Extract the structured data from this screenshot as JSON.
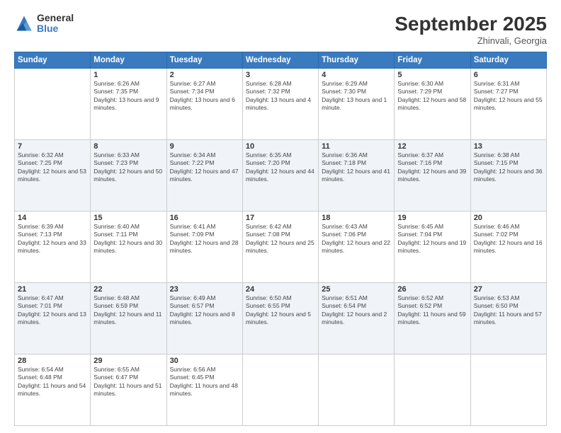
{
  "logo": {
    "general": "General",
    "blue": "Blue"
  },
  "header": {
    "month": "September 2025",
    "location": "Zhinvali, Georgia"
  },
  "days_of_week": [
    "Sunday",
    "Monday",
    "Tuesday",
    "Wednesday",
    "Thursday",
    "Friday",
    "Saturday"
  ],
  "weeks": [
    [
      {
        "day": "",
        "sunrise": "",
        "sunset": "",
        "daylight": ""
      },
      {
        "day": "1",
        "sunrise": "Sunrise: 6:26 AM",
        "sunset": "Sunset: 7:35 PM",
        "daylight": "Daylight: 13 hours and 9 minutes."
      },
      {
        "day": "2",
        "sunrise": "Sunrise: 6:27 AM",
        "sunset": "Sunset: 7:34 PM",
        "daylight": "Daylight: 13 hours and 6 minutes."
      },
      {
        "day": "3",
        "sunrise": "Sunrise: 6:28 AM",
        "sunset": "Sunset: 7:32 PM",
        "daylight": "Daylight: 13 hours and 4 minutes."
      },
      {
        "day": "4",
        "sunrise": "Sunrise: 6:29 AM",
        "sunset": "Sunset: 7:30 PM",
        "daylight": "Daylight: 13 hours and 1 minute."
      },
      {
        "day": "5",
        "sunrise": "Sunrise: 6:30 AM",
        "sunset": "Sunset: 7:29 PM",
        "daylight": "Daylight: 12 hours and 58 minutes."
      },
      {
        "day": "6",
        "sunrise": "Sunrise: 6:31 AM",
        "sunset": "Sunset: 7:27 PM",
        "daylight": "Daylight: 12 hours and 55 minutes."
      }
    ],
    [
      {
        "day": "7",
        "sunrise": "Sunrise: 6:32 AM",
        "sunset": "Sunset: 7:25 PM",
        "daylight": "Daylight: 12 hours and 53 minutes."
      },
      {
        "day": "8",
        "sunrise": "Sunrise: 6:33 AM",
        "sunset": "Sunset: 7:23 PM",
        "daylight": "Daylight: 12 hours and 50 minutes."
      },
      {
        "day": "9",
        "sunrise": "Sunrise: 6:34 AM",
        "sunset": "Sunset: 7:22 PM",
        "daylight": "Daylight: 12 hours and 47 minutes."
      },
      {
        "day": "10",
        "sunrise": "Sunrise: 6:35 AM",
        "sunset": "Sunset: 7:20 PM",
        "daylight": "Daylight: 12 hours and 44 minutes."
      },
      {
        "day": "11",
        "sunrise": "Sunrise: 6:36 AM",
        "sunset": "Sunset: 7:18 PM",
        "daylight": "Daylight: 12 hours and 41 minutes."
      },
      {
        "day": "12",
        "sunrise": "Sunrise: 6:37 AM",
        "sunset": "Sunset: 7:16 PM",
        "daylight": "Daylight: 12 hours and 39 minutes."
      },
      {
        "day": "13",
        "sunrise": "Sunrise: 6:38 AM",
        "sunset": "Sunset: 7:15 PM",
        "daylight": "Daylight: 12 hours and 36 minutes."
      }
    ],
    [
      {
        "day": "14",
        "sunrise": "Sunrise: 6:39 AM",
        "sunset": "Sunset: 7:13 PM",
        "daylight": "Daylight: 12 hours and 33 minutes."
      },
      {
        "day": "15",
        "sunrise": "Sunrise: 6:40 AM",
        "sunset": "Sunset: 7:11 PM",
        "daylight": "Daylight: 12 hours and 30 minutes."
      },
      {
        "day": "16",
        "sunrise": "Sunrise: 6:41 AM",
        "sunset": "Sunset: 7:09 PM",
        "daylight": "Daylight: 12 hours and 28 minutes."
      },
      {
        "day": "17",
        "sunrise": "Sunrise: 6:42 AM",
        "sunset": "Sunset: 7:08 PM",
        "daylight": "Daylight: 12 hours and 25 minutes."
      },
      {
        "day": "18",
        "sunrise": "Sunrise: 6:43 AM",
        "sunset": "Sunset: 7:06 PM",
        "daylight": "Daylight: 12 hours and 22 minutes."
      },
      {
        "day": "19",
        "sunrise": "Sunrise: 6:45 AM",
        "sunset": "Sunset: 7:04 PM",
        "daylight": "Daylight: 12 hours and 19 minutes."
      },
      {
        "day": "20",
        "sunrise": "Sunrise: 6:46 AM",
        "sunset": "Sunset: 7:02 PM",
        "daylight": "Daylight: 12 hours and 16 minutes."
      }
    ],
    [
      {
        "day": "21",
        "sunrise": "Sunrise: 6:47 AM",
        "sunset": "Sunset: 7:01 PM",
        "daylight": "Daylight: 12 hours and 13 minutes."
      },
      {
        "day": "22",
        "sunrise": "Sunrise: 6:48 AM",
        "sunset": "Sunset: 6:59 PM",
        "daylight": "Daylight: 12 hours and 11 minutes."
      },
      {
        "day": "23",
        "sunrise": "Sunrise: 6:49 AM",
        "sunset": "Sunset: 6:57 PM",
        "daylight": "Daylight: 12 hours and 8 minutes."
      },
      {
        "day": "24",
        "sunrise": "Sunrise: 6:50 AM",
        "sunset": "Sunset: 6:55 PM",
        "daylight": "Daylight: 12 hours and 5 minutes."
      },
      {
        "day": "25",
        "sunrise": "Sunrise: 6:51 AM",
        "sunset": "Sunset: 6:54 PM",
        "daylight": "Daylight: 12 hours and 2 minutes."
      },
      {
        "day": "26",
        "sunrise": "Sunrise: 6:52 AM",
        "sunset": "Sunset: 6:52 PM",
        "daylight": "Daylight: 11 hours and 59 minutes."
      },
      {
        "day": "27",
        "sunrise": "Sunrise: 6:53 AM",
        "sunset": "Sunset: 6:50 PM",
        "daylight": "Daylight: 11 hours and 57 minutes."
      }
    ],
    [
      {
        "day": "28",
        "sunrise": "Sunrise: 6:54 AM",
        "sunset": "Sunset: 6:48 PM",
        "daylight": "Daylight: 11 hours and 54 minutes."
      },
      {
        "day": "29",
        "sunrise": "Sunrise: 6:55 AM",
        "sunset": "Sunset: 6:47 PM",
        "daylight": "Daylight: 11 hours and 51 minutes."
      },
      {
        "day": "30",
        "sunrise": "Sunrise: 6:56 AM",
        "sunset": "Sunset: 6:45 PM",
        "daylight": "Daylight: 11 hours and 48 minutes."
      },
      {
        "day": "",
        "sunrise": "",
        "sunset": "",
        "daylight": ""
      },
      {
        "day": "",
        "sunrise": "",
        "sunset": "",
        "daylight": ""
      },
      {
        "day": "",
        "sunrise": "",
        "sunset": "",
        "daylight": ""
      },
      {
        "day": "",
        "sunrise": "",
        "sunset": "",
        "daylight": ""
      }
    ]
  ]
}
